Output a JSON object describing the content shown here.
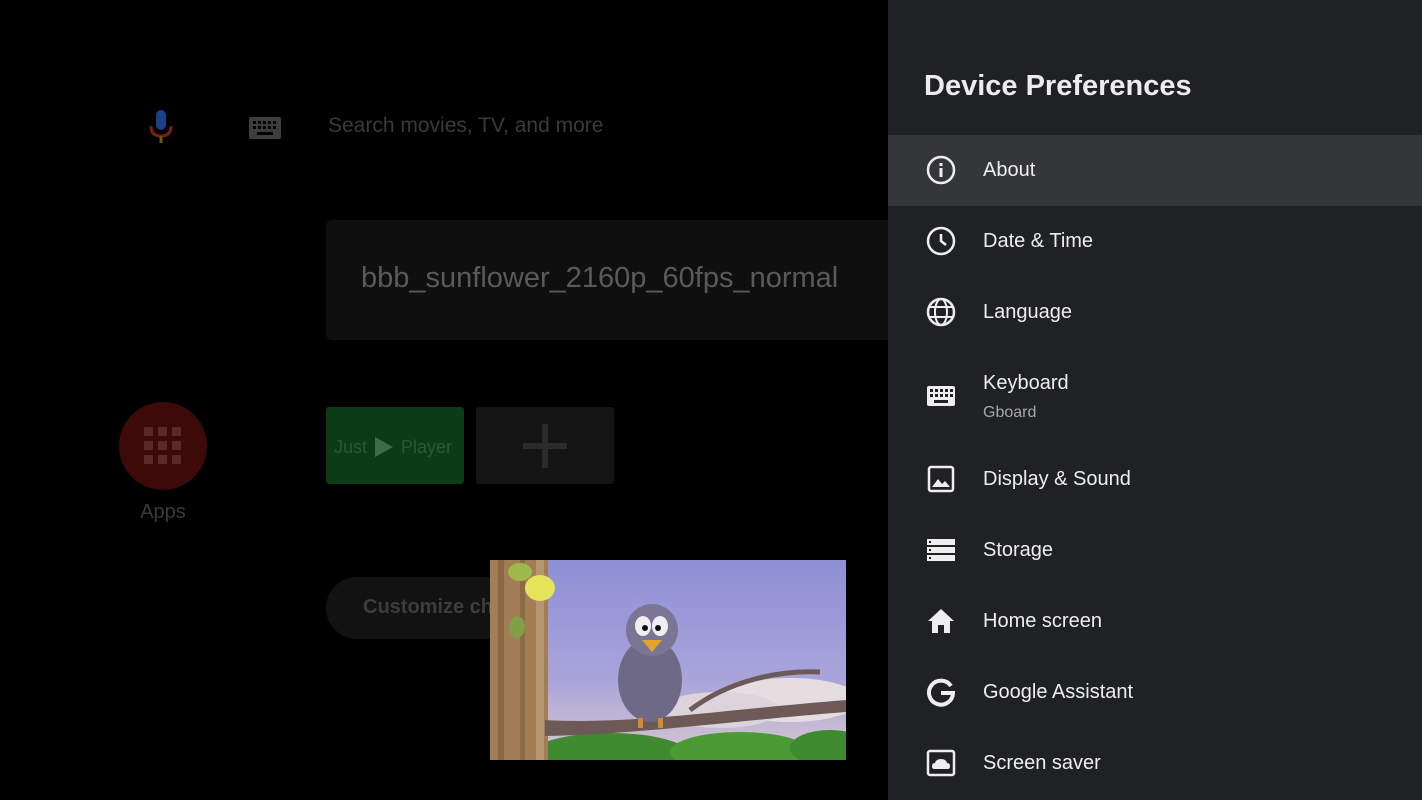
{
  "launcher": {
    "search_placeholder": "Search movies, TV, and more",
    "now_playing_title": "bbb_sunflower_2160p_60fps_normal",
    "apps_label": "Apps",
    "player_tile_left": "Just",
    "player_tile_right": "Player",
    "customize_label": "Customize channels"
  },
  "panel": {
    "title": "Device Preferences",
    "items": [
      {
        "label": "About",
        "icon": "info-icon"
      },
      {
        "label": "Date & Time",
        "icon": "clock-icon"
      },
      {
        "label": "Language",
        "icon": "globe-icon"
      },
      {
        "label": "Keyboard",
        "sublabel": "Gboard",
        "icon": "keyboard-icon"
      },
      {
        "label": "Display & Sound",
        "icon": "image-icon"
      },
      {
        "label": "Storage",
        "icon": "storage-icon"
      },
      {
        "label": "Home screen",
        "icon": "home-icon"
      },
      {
        "label": "Google Assistant",
        "icon": "google-g-icon"
      },
      {
        "label": "Screen saver",
        "icon": "screensaver-icon"
      }
    ]
  },
  "colors": {
    "panel_bg": "#202124",
    "selected_bg": "#35363a",
    "text": "#eeeeee"
  }
}
